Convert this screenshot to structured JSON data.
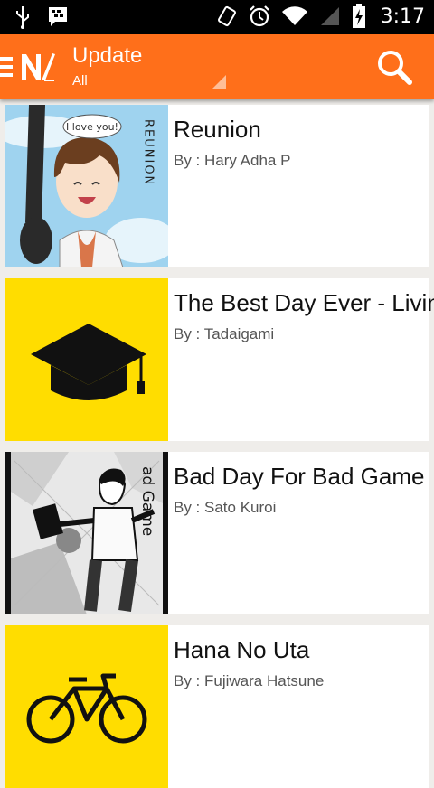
{
  "status_bar": {
    "time": "3:17",
    "icons": [
      "usb-icon",
      "bbm-icon",
      "vibrate-icon",
      "alarm-icon",
      "wifi-icon",
      "signal-icon",
      "battery-charging-icon"
    ]
  },
  "app_bar": {
    "title": "Update",
    "subtitle": "All",
    "logo_icon": "nl-logo",
    "menu_icon": "menu-icon",
    "search_icon": "search-icon",
    "accent": "#ff6f1a"
  },
  "books": [
    {
      "title": "Reunion",
      "author": "By : Hary Adha P",
      "cover": "illustrated-cover",
      "cover_texts": [
        "I love you!",
        "REUNION"
      ]
    },
    {
      "title": "The Best Day Ever - Living",
      "author": "By : Tadaigami",
      "cover": "graduation-cap-icon",
      "cover_color": "#ffdd00"
    },
    {
      "title": "Bad Day For Bad Game",
      "author": "By : Sato Kuroi",
      "cover": "manga-cover",
      "cover_texts": [
        "ad Game"
      ]
    },
    {
      "title": "Hana No Uta",
      "author": "By : Fujiwara Hatsune",
      "cover": "bicycle-icon",
      "cover_color": "#ffdd00"
    }
  ]
}
